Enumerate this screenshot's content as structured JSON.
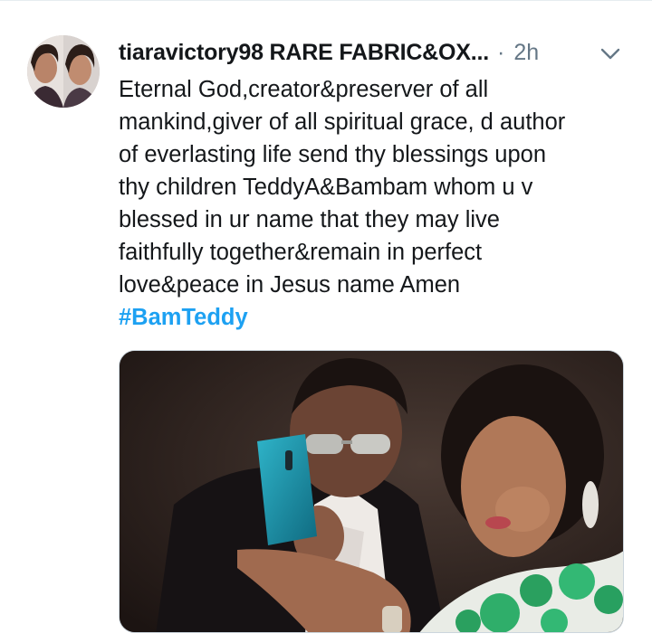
{
  "tweet": {
    "author": "tiaravictory98 RARE FABRIC&OX...",
    "separator": "·",
    "time": "2h",
    "text_lines": [
      "Eternal God,creator&preserver of all",
      "mankind,giver of all spiritual grace, d author",
      "of everlasting life send thy blessings upon",
      "thy children TeddyA&Bambam whom u v",
      "blessed in ur name that they may live",
      "faithfully together&remain in perfect",
      "love&peace in Jesus name Amen"
    ],
    "hashtag": "#BamTeddy",
    "menu_icon": "chevron-down-icon",
    "avatar_icon": "profile-photo"
  },
  "colors": {
    "text": "#14171a",
    "muted": "#657786",
    "link": "#1da1f2",
    "border": "#e6ecf0"
  }
}
